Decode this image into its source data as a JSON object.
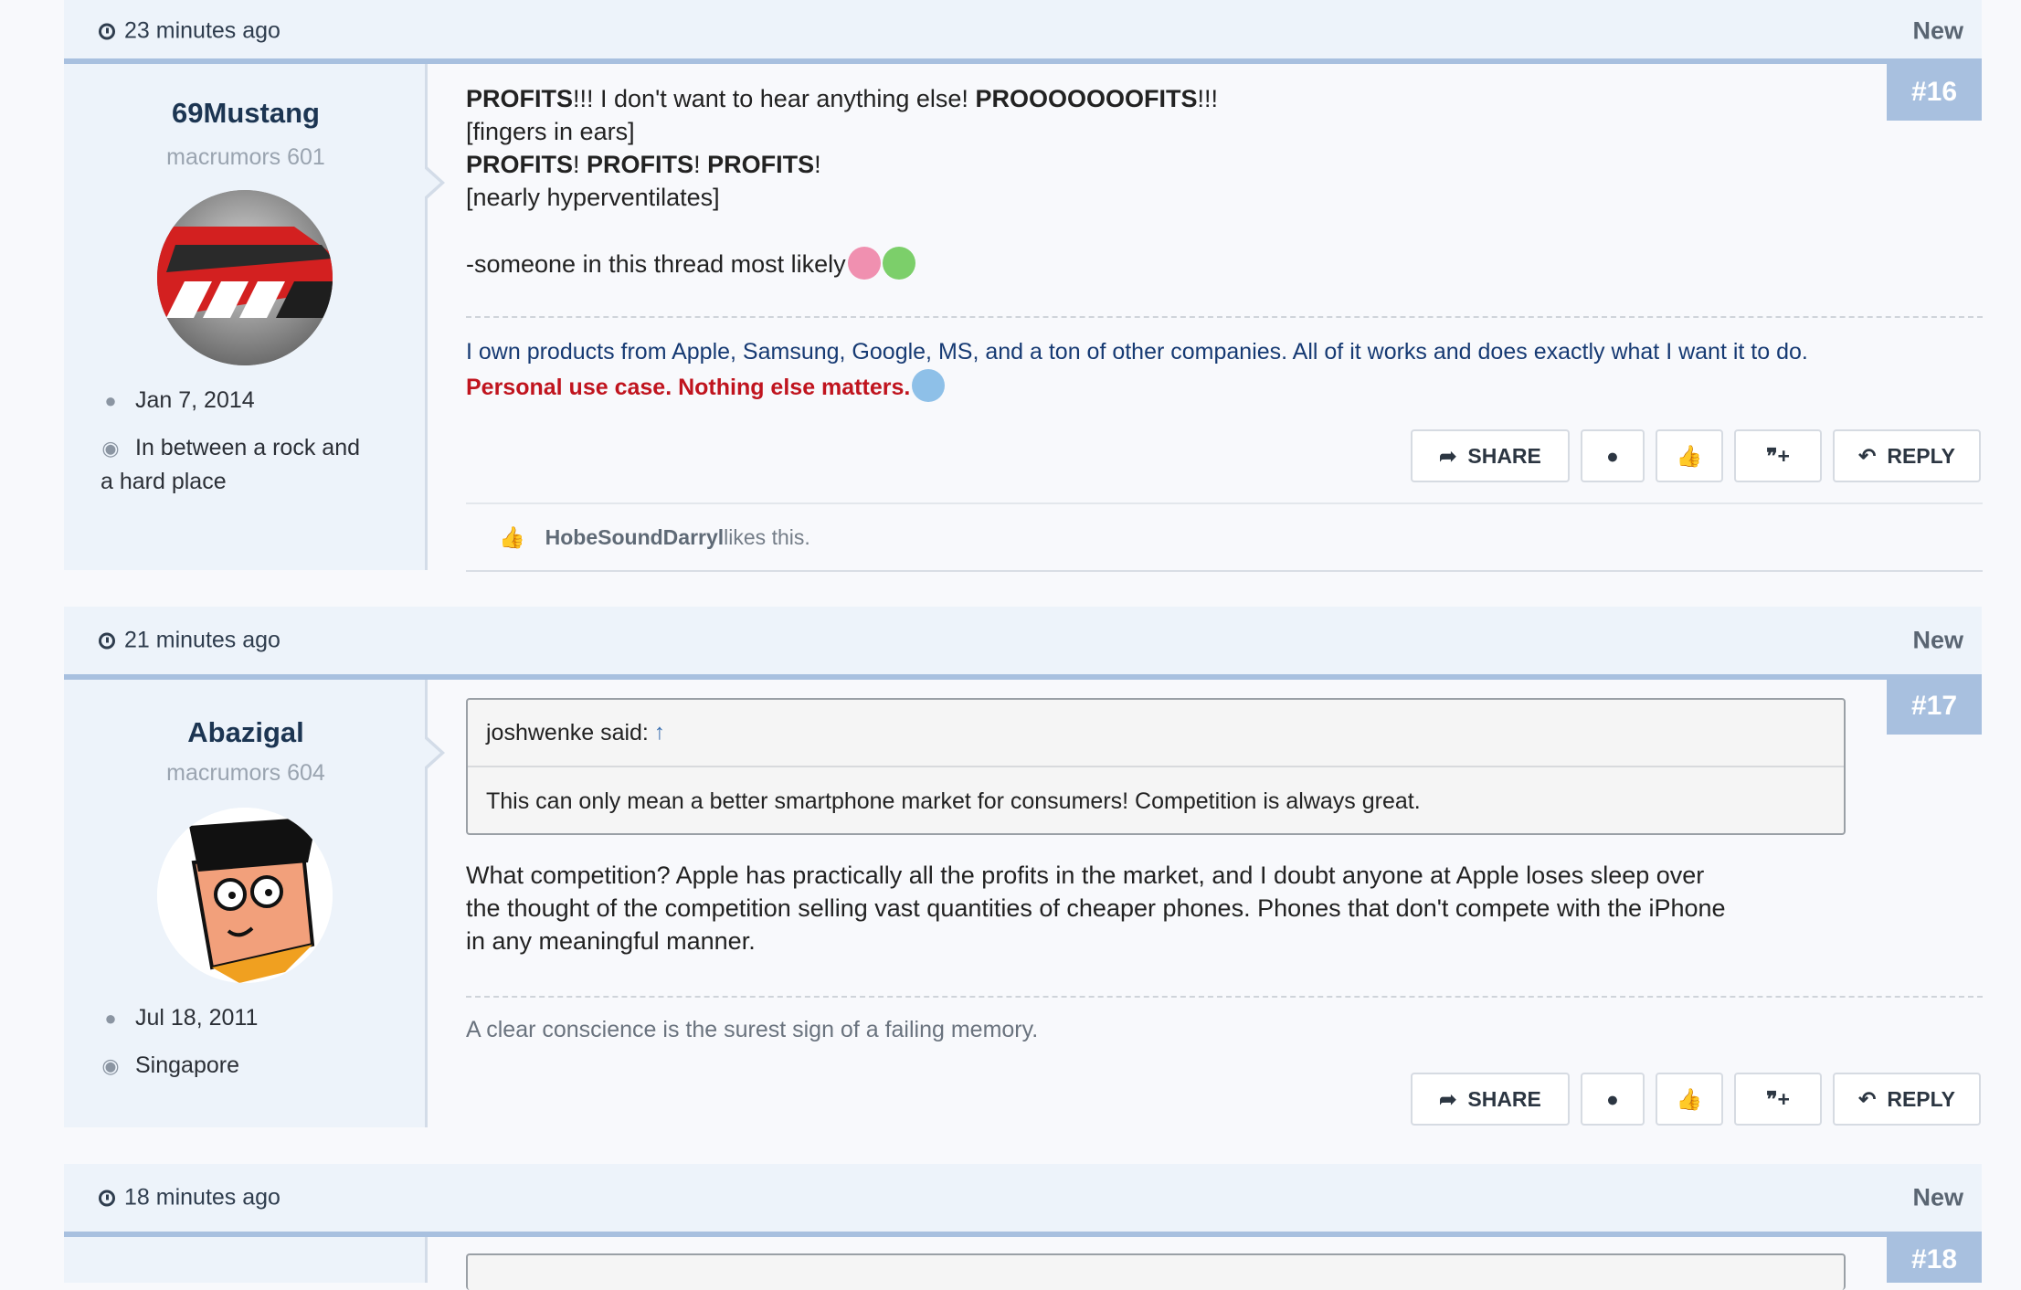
{
  "posts": [
    {
      "time": "23 minutes ago",
      "new_label": "New",
      "number": "#16",
      "user": {
        "name": "69Mustang",
        "title": "macrumors 601",
        "joined": "Jan 7, 2014",
        "location": "In between a rock and a hard place"
      },
      "message": {
        "line1_b1": "PROFITS",
        "line1_t1": "!!! I don't want to hear anything else! ",
        "line1_b2": "PROOOOOOOFITS",
        "line1_t2": "!!!",
        "line2": "[fingers in ears]",
        "line3_w1": "PROFITS",
        "line3_w2": "PROFITS",
        "line3_w3": "PROFITS",
        "excl": "!",
        "line4": "[nearly hyperventilates]",
        "line5": "-someone in this thread most likely"
      },
      "signature": {
        "text": "I own products from Apple, Samsung, Google, MS, and a ton of other companies. All of it works and does exactly what I want it to do.",
        "red_text": "Personal use case. Nothing else matters."
      },
      "actions": [
        "SHARE",
        "REPLY"
      ],
      "likes": {
        "user": "HobeSoundDarryl",
        "text": " likes this."
      }
    },
    {
      "time": "21 minutes ago",
      "new_label": "New",
      "number": "#17",
      "user": {
        "name": "Abazigal",
        "title": "macrumors 604",
        "joined": "Jul 18, 2011",
        "location": "Singapore"
      },
      "quote": {
        "author": "joshwenke said:",
        "up": "↑",
        "text": "This can only mean a better smartphone market for consumers! Competition is always great."
      },
      "message": {
        "p1": "What competition? Apple has practically all the profits in the market, and I doubt anyone at Apple loses sleep over",
        "p2": "the thought of the competition selling vast quantities of cheaper phones. Phones that don't compete with the iPhone",
        "p3": "in any meaningful manner."
      },
      "signature": {
        "text": "A clear conscience is the surest sign of a failing memory."
      },
      "actions": [
        "SHARE",
        "REPLY"
      ]
    },
    {
      "time": "18 minutes ago",
      "new_label": "New",
      "number": "#18"
    }
  ],
  "colors": {
    "accent": "#a8c0df",
    "panel": "#edf3fa",
    "signature_red": "#c0141e",
    "signature_blue": "#163a73"
  },
  "icons": [
    "clock-icon",
    "share-icon",
    "report-icon",
    "like-icon",
    "multiquote-icon",
    "reply-icon",
    "user-icon",
    "location-icon"
  ]
}
